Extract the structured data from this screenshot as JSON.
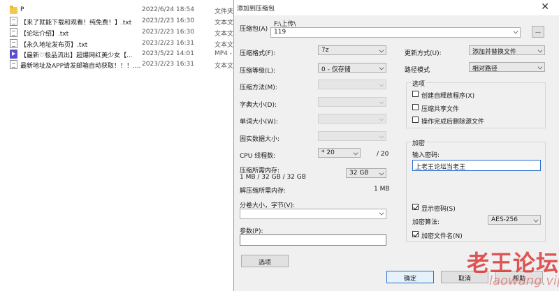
{
  "files": [
    {
      "name": "P",
      "date": "2022/6/24 18:54",
      "type": "文件夹",
      "icon": "folder-icon"
    },
    {
      "name": "【来了就能下载和观看！纯免费！】.txt",
      "date": "2023/2/23 16:30",
      "type": "文本文",
      "icon": "text-file-icon"
    },
    {
      "name": "【论坛介绍】.txt",
      "date": "2023/2/23 16:30",
      "type": "文本文",
      "icon": "text-file-icon"
    },
    {
      "name": "【永久地址发布页】.txt",
      "date": "2023/2/23 16:31",
      "type": "文本文",
      "icon": "text-file-icon"
    },
    {
      "name": "【最新♡极品流出】超爆网红美少女【...",
      "date": "2023/5/22 14:01",
      "type": "MP4 -",
      "icon": "video-file-icon"
    },
    {
      "name": "最新地址及APP请发邮箱自动获取！！！....",
      "date": "2023/2/23 16:31",
      "type": "文本文",
      "icon": "text-file-icon"
    }
  ],
  "dialog": {
    "title": "添加到压缩包",
    "close_glyph": "✕",
    "archive_label": "压缩包(A)",
    "archive_path": "F:\\上传\\",
    "archive_name": "119",
    "browse_label": "...",
    "format_label": "压缩格式(F):",
    "format_value": "7z",
    "level_label": "压缩等级(L):",
    "level_value": "0 - 仅存储",
    "method_label": "压缩方法(M):",
    "dict_label": "字典大小(D):",
    "word_label": "单词大小(W):",
    "solid_label": "固实数据大小:",
    "cpu_label": "CPU 线程数:",
    "cpu_value": "* 20",
    "cpu_max": "/ 20",
    "mem_label": "压缩所需内存:",
    "mem_info": "1 MB / 32 GB / 32 GB",
    "mem_value": "32 GB",
    "decomp_label": "解压缩所需内存:",
    "decomp_value": "1 MB",
    "volume_label": "分卷大小，字节(V):",
    "volume_value": "",
    "params_label": "参数(P):",
    "params_value": "",
    "options_button": "选项",
    "update_label": "更新方式(U):",
    "update_value": "添加并替换文件",
    "path_label": "路径模式",
    "path_value": "相对路径",
    "options_group": "选项",
    "opt_sfx": "创建自释放程序(X)",
    "opt_shared": "压缩共享文件",
    "opt_delete": "操作完成后删除源文件",
    "encrypt_group": "加密",
    "password_label": "输入密码:",
    "password_value": "上老王论坛当老王",
    "show_password": "显示密码(S)",
    "algo_label": "加密算法:",
    "algo_value": "AES-256",
    "encrypt_names": "加密文件名(N)",
    "ok_button": "确定",
    "cancel_button": "取消",
    "help_button": "帮助"
  },
  "watermark": {
    "text": "老王论坛",
    "sub": "laowang.vip"
  }
}
